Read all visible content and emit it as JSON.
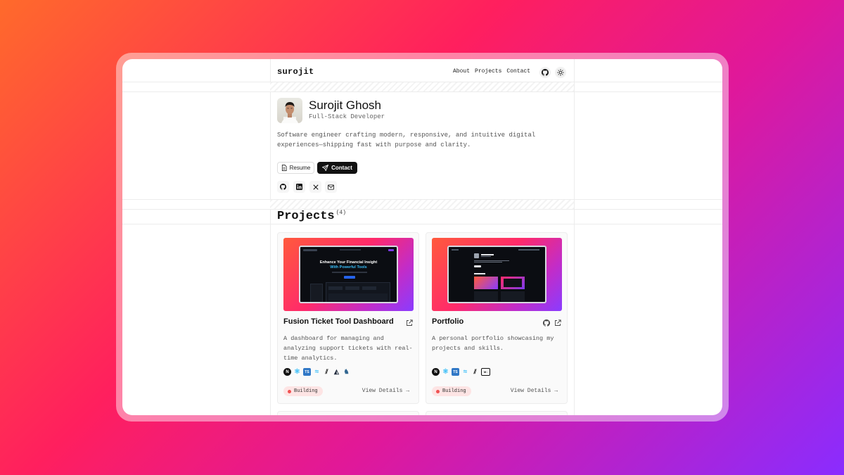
{
  "navbar": {
    "brand": "surojit",
    "links": [
      "About",
      "Projects",
      "Contact"
    ],
    "icons": [
      "github-icon",
      "sun-icon"
    ]
  },
  "hero": {
    "name": "Surojit Ghosh",
    "role": "Full-Stack Developer",
    "bio": "Software engineer crafting modern, responsive, and intuitive digital experiences—shipping fast with purpose and clarity.",
    "buttons": {
      "resume": "Resume",
      "contact": "Contact"
    },
    "socials": [
      "github-icon",
      "linkedin-icon",
      "x-icon",
      "mail-icon"
    ]
  },
  "projects": {
    "title": "Projects",
    "count": "(4)",
    "items": [
      {
        "title": "Fusion Ticket Tool Dashboard",
        "description": "A dashboard for managing and analyzing support tickets with real-time analytics.",
        "status": "Building",
        "details_label": "View Details →",
        "preview_heading": "Enhance Your Financial Insight",
        "preview_subheading": "With Powerful Tools",
        "tech_icons": [
          "nextjs-icon",
          "react-icon",
          "typescript-icon",
          "tailwind-icon",
          "shadcn-icon",
          "prisma-icon",
          "postgresql-icon"
        ],
        "links": [
          "external-link-icon"
        ]
      },
      {
        "title": "Portfolio",
        "description": "A personal portfolio showcasing my projects and skills.",
        "status": "Building",
        "details_label": "View Details →",
        "tech_icons": [
          "nextjs-icon",
          "react-icon",
          "typescript-icon",
          "tailwind-icon",
          "shadcn-icon",
          "mdx-icon"
        ],
        "links": [
          "github-icon",
          "external-link-icon"
        ]
      }
    ]
  },
  "colors": {
    "accent_dark": "#111111",
    "badge_bg": "#fde4e4",
    "badge_dot": "#f05252",
    "preview_cyan": "#38bdf8"
  }
}
